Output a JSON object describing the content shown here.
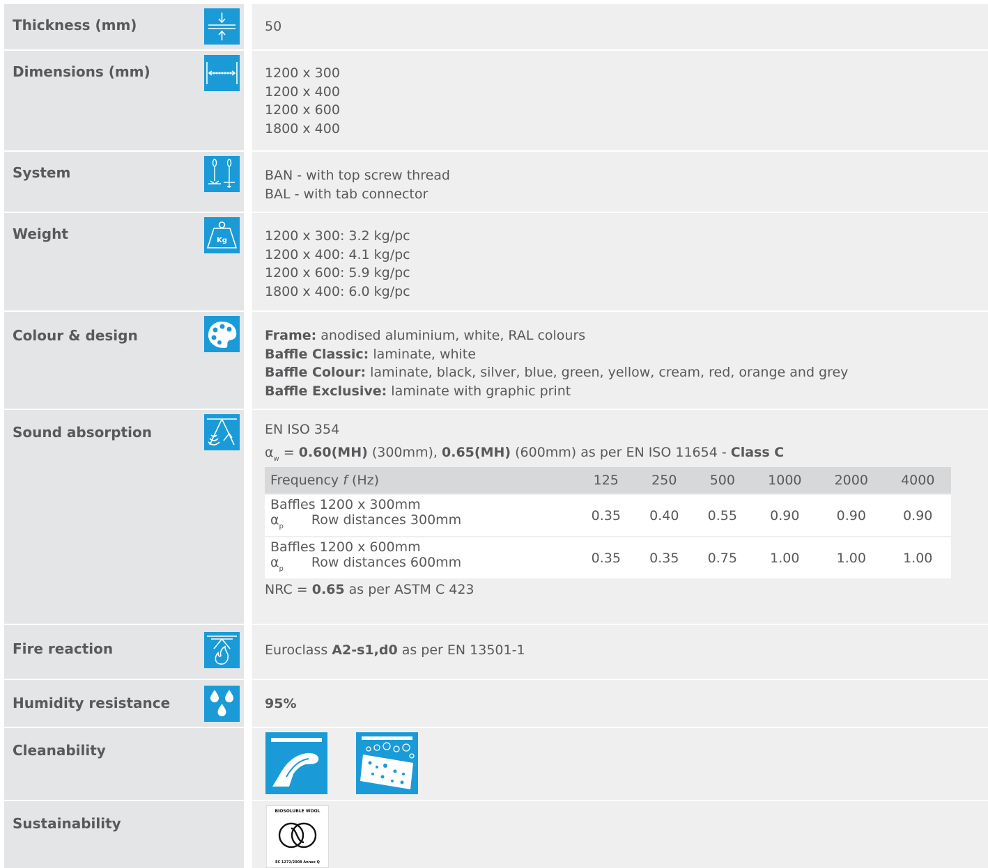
{
  "rows": {
    "thickness": {
      "label": "Thickness (mm)",
      "value": "50",
      "icon": "thickness-icon"
    },
    "dimensions": {
      "label": "Dimensions (mm)",
      "values": [
        "1200 x 300",
        "1200 x 400",
        "1200 x 600",
        "1800 x 400"
      ],
      "icon": "dimensions-icon"
    },
    "system": {
      "label": "System",
      "values": [
        "BAN - with top screw thread",
        "BAL - with tab connector"
      ],
      "icon": "system-icon"
    },
    "weight": {
      "label": "Weight",
      "values": [
        "1200 x 300: 3.2 kg/pc",
        "1200 x 400: 4.1 kg/pc",
        "1200 x 600: 5.9 kg/pc",
        "1800 x 400: 6.0 kg/pc"
      ],
      "icon": "weight-icon",
      "icon_text": "Kg"
    },
    "colour": {
      "label": "Colour & design",
      "icon": "palette-icon",
      "items": [
        {
          "key": "Frame:",
          "text": " anodised aluminium, white, RAL colours"
        },
        {
          "key": "Baffle Classic:",
          "text": " laminate, white"
        },
        {
          "key": "Baffle Colour:",
          "text": " laminate, black, silver, blue, green, yellow, cream, red, orange and grey"
        },
        {
          "key": "Baffle Exclusive:",
          "text": " laminate with graphic print"
        }
      ]
    },
    "sound": {
      "label": "Sound absorption",
      "icon": "sound-absorption-icon",
      "standard": "EN ISO 354",
      "aw_symbol": "α",
      "aw_sub": "w",
      "aw_eq": " = ",
      "aw_v1": "0.60(MH)",
      "aw_t1": " (300mm), ",
      "aw_v2": "0.65(MH)",
      "aw_t2": " (600mm) as per EN ISO 11654 - ",
      "aw_class": "Class C",
      "table": {
        "header_label": "Frequency ",
        "header_f": "f",
        "header_unit": " (Hz)",
        "frequencies": [
          "125",
          "250",
          "500",
          "1000",
          "2000",
          "4000"
        ],
        "rows": [
          {
            "line1": "Baffles 1200 x 300mm",
            "symbol": "α",
            "sub": "p",
            "line2": "Row distances 300mm",
            "values": [
              "0.35",
              "0.40",
              "0.55",
              "0.90",
              "0.90",
              "0.90"
            ]
          },
          {
            "line1": "Baffles 1200 x 600mm",
            "symbol": "α",
            "sub": "p",
            "line2": "Row distances 600mm",
            "values": [
              "0.35",
              "0.35",
              "0.75",
              "1.00",
              "1.00",
              "1.00"
            ]
          }
        ]
      },
      "nrc_prefix": "NRC = ",
      "nrc_value": "0.65",
      "nrc_suffix": " as per ASTM C 423"
    },
    "fire": {
      "label": "Fire reaction",
      "icon": "fire-reaction-icon",
      "prefix": "Euroclass ",
      "value": "A2-s1,d0",
      "suffix": " as per EN 13501-1"
    },
    "humidity": {
      "label": "Humidity resistance",
      "icon": "humidity-icon",
      "value": "95%"
    },
    "cleanability": {
      "label": "Cleanability",
      "icons": [
        "wipe-clean-icon",
        "wash-icon"
      ]
    },
    "sustainability": {
      "label": "Sustainability",
      "badge_top": "BIOSOLUBLE WOOL",
      "badge_bottom": "EC 1272/2008 Annex Q"
    }
  },
  "colors": {
    "accent": "#1a9bd7",
    "label_bg": "#e4e5e6",
    "value_bg": "#efeff0",
    "table_header": "#d7d8d9",
    "text": "#58595b"
  }
}
